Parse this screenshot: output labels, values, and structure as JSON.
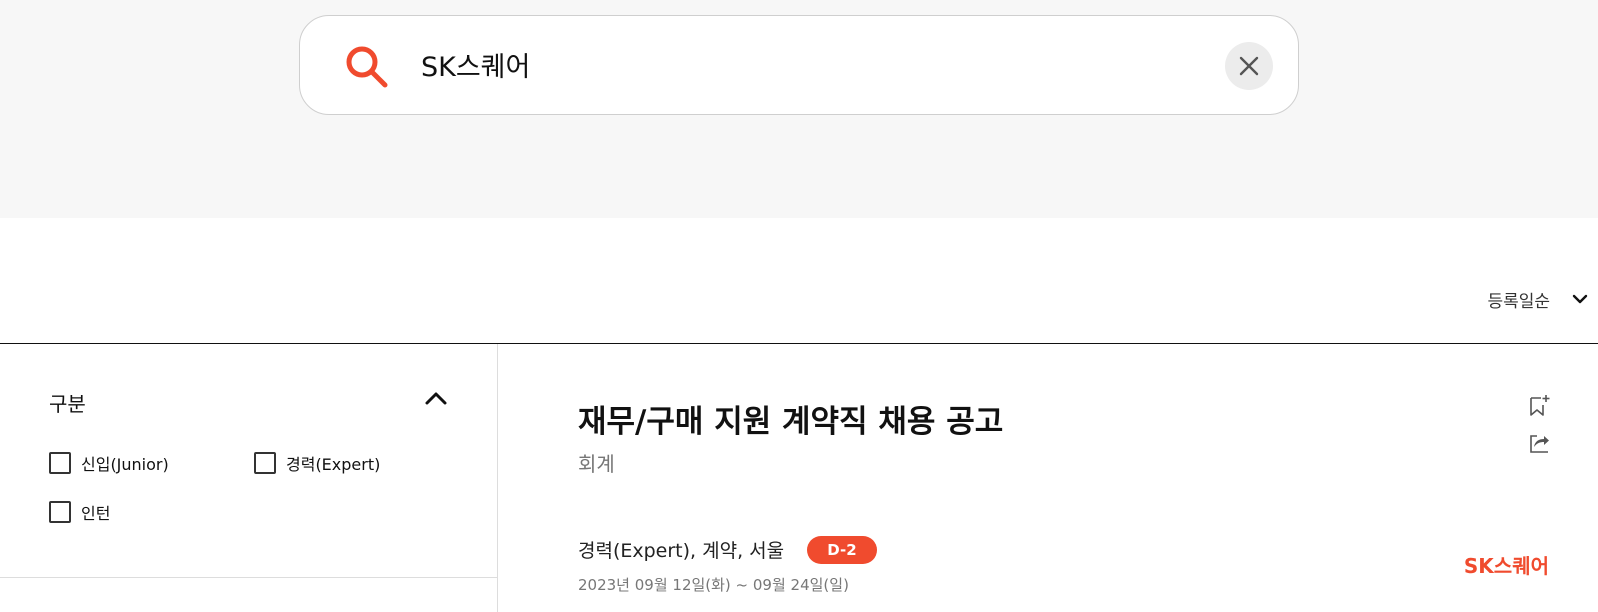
{
  "search": {
    "query": "SK스퀘어",
    "icon": "search-icon",
    "clear_icon": "close-icon"
  },
  "sort": {
    "label": "등록일순",
    "icon": "chevron-down-icon"
  },
  "filter": {
    "title": "구분",
    "collapse_icon": "chevron-up-icon",
    "options": [
      {
        "label": "신입(Junior)",
        "checked": false
      },
      {
        "label": "경력(Expert)",
        "checked": false
      },
      {
        "label": "인턴",
        "checked": false
      }
    ]
  },
  "job": {
    "title": "재무/구매 지원 계약직 채용 공고",
    "category": "회계",
    "meta": "경력(Expert), 계약, 서울",
    "dday": "D-2",
    "dates": "2023년 09월 12일(화) ~ 09월 24일(일)",
    "company": "SK스퀘어",
    "bookmark_icon": "bookmark-add-icon",
    "share_icon": "share-icon"
  },
  "colors": {
    "accent": "#f04b2e",
    "background_top": "#f7f7f7"
  }
}
